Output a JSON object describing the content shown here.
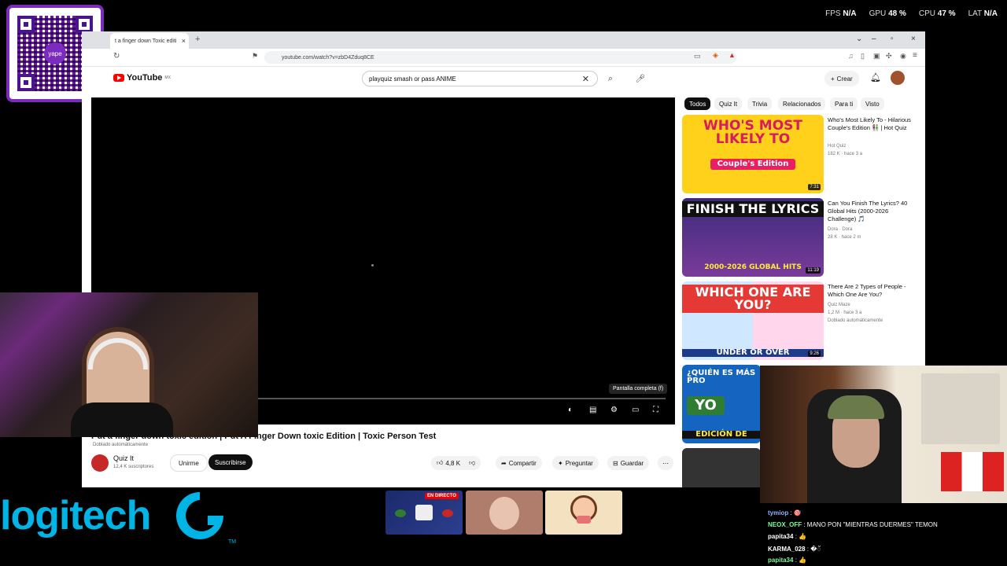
{
  "perf": [
    {
      "label": "FPS",
      "value": "N/A"
    },
    {
      "label": "GPU",
      "value": "48 %"
    },
    {
      "label": "CPU",
      "value": "47 %"
    },
    {
      "label": "LAT",
      "value": "N/A"
    }
  ],
  "qr": {
    "brand": "yape"
  },
  "browser": {
    "tab_title": "t a finger down Toxic editi",
    "url": "youtube.com/watch?v=zbD4Zduq8CE"
  },
  "youtube": {
    "logo": "YouTube",
    "region": "MX",
    "search_value": "playquiz smash or pass ANIME",
    "create_label": "Crear",
    "notifications": "9+"
  },
  "player": {
    "fullscreen_hint": "Pantalla completa (f)"
  },
  "video": {
    "title": "Put a finger down toxic edition | Put A Finger Down toxic Edition | Toxic Person Test",
    "dubbed": "Doblado automáticamente",
    "channel": "Quiz It",
    "subscribers": "12,4 K suscriptores",
    "join_label": "Unirme",
    "subscribe_label": "Suscribirse",
    "likes": "4,8 K",
    "share_label": "Compartir",
    "ask_label": "Preguntar",
    "save_label": "Guardar"
  },
  "chips": [
    "Todos",
    "Quiz It",
    "Trivia",
    "Relacionados",
    "Para ti",
    "Visto"
  ],
  "recommendations": [
    {
      "thumb_text": "WHO'S MOST LIKELY TO",
      "thumb_sub": "Couple's Edition",
      "duration": "7:31",
      "title": "Who's Most Likely To - Hilarious Couple's Edition 👫 | Hot Quiz",
      "channel": "Hot Quiz",
      "stats": "182 K · hace 3 a"
    },
    {
      "thumb_text": "FINISH THE LYRICS",
      "thumb_sub": "2000-2026 GLOBAL HITS",
      "duration": "11:19",
      "title": "Can You Finish The Lyrics? 40 Global Hits (2000-2026 Challenge) 🎵",
      "channel": "Dora · Dora",
      "stats": "28 K · hace 2 m"
    },
    {
      "thumb_text": "WHICH ONE ARE YOU?",
      "thumb_sub": "UNDER   OR   OVER",
      "duration": "9:26",
      "title": "There Are 2 Types of People - Which One Are You?",
      "channel": "Quiz Maze",
      "stats": "1,2 M · hace 3 a",
      "badge": "Doblado automáticamente"
    },
    {
      "thumb_text": "¿QUIÉN ES MÁS PRO",
      "thumb_sub": "YO",
      "thumb_sub2": "EDICIÓN DE"
    }
  ],
  "overlay": {
    "logitech": "logitech",
    "tm": "TM",
    "live": "EN DIRECTO"
  },
  "chat": [
    {
      "user": "tymiop",
      "message": "🎯"
    },
    {
      "user": "NEOX_OFF",
      "message": "MANO PON \"MIENTRAS DUERMES\" TEMON"
    },
    {
      "user": "papita34",
      "message": "👍"
    },
    {
      "user": "KARMA_028",
      "message": "�ॅ"
    },
    {
      "user": "papita34",
      "message": "👍"
    }
  ],
  "colors": {
    "accent_youtube": "#ff0000",
    "logitech_blue": "#00b4e6",
    "yape_purple": "#7b2cbf"
  }
}
